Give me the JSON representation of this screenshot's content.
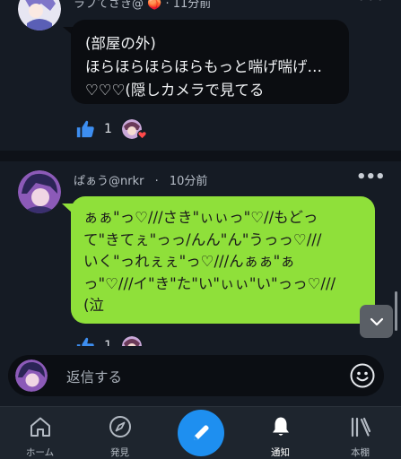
{
  "post1": {
    "meta_text": "ラブてさき@ 🍑 · 11分前",
    "lines": [
      "(部屋の外)",
      "ほらほらほらほらもっと喘げ喘げ…",
      "♡♡♡(隠しカメラで見てる"
    ],
    "like_count": "1",
    "more_label": "•••"
  },
  "post2": {
    "author": "ぱぁう@nrkr",
    "separator": "·",
    "time": "10分前",
    "more_label": "•••",
    "lines": [
      "ぁぁ\"っ♡///さき\"ぃぃっ\"♡//もどっ",
      "て\"きてぇ\"っっ/んん\"ん\"うっっ♡///",
      "いく\"っれぇぇ\"っ♡///んぁぁ\"ぁ",
      "っ\"♡///イ\"き\"た\"い\"ぃぃ\"い\"っっ♡///",
      "(泣"
    ],
    "like_count": "1"
  },
  "reply": {
    "placeholder": "返信する"
  },
  "tabs": [
    {
      "label": "ホーム",
      "icon": "home-icon"
    },
    {
      "label": "発見",
      "icon": "compass-icon"
    },
    {
      "label": "",
      "icon": "pencil-icon"
    },
    {
      "label": "通知",
      "icon": "bell-icon"
    },
    {
      "label": "本棚",
      "icon": "bookshelf-icon"
    }
  ],
  "colors": {
    "background": "#151b24",
    "bubble_dark": "#0b0d11",
    "bubble_green": "#8fe03a",
    "accent_blue": "#1e8ff0",
    "like_blue": "#3d8ef0"
  }
}
